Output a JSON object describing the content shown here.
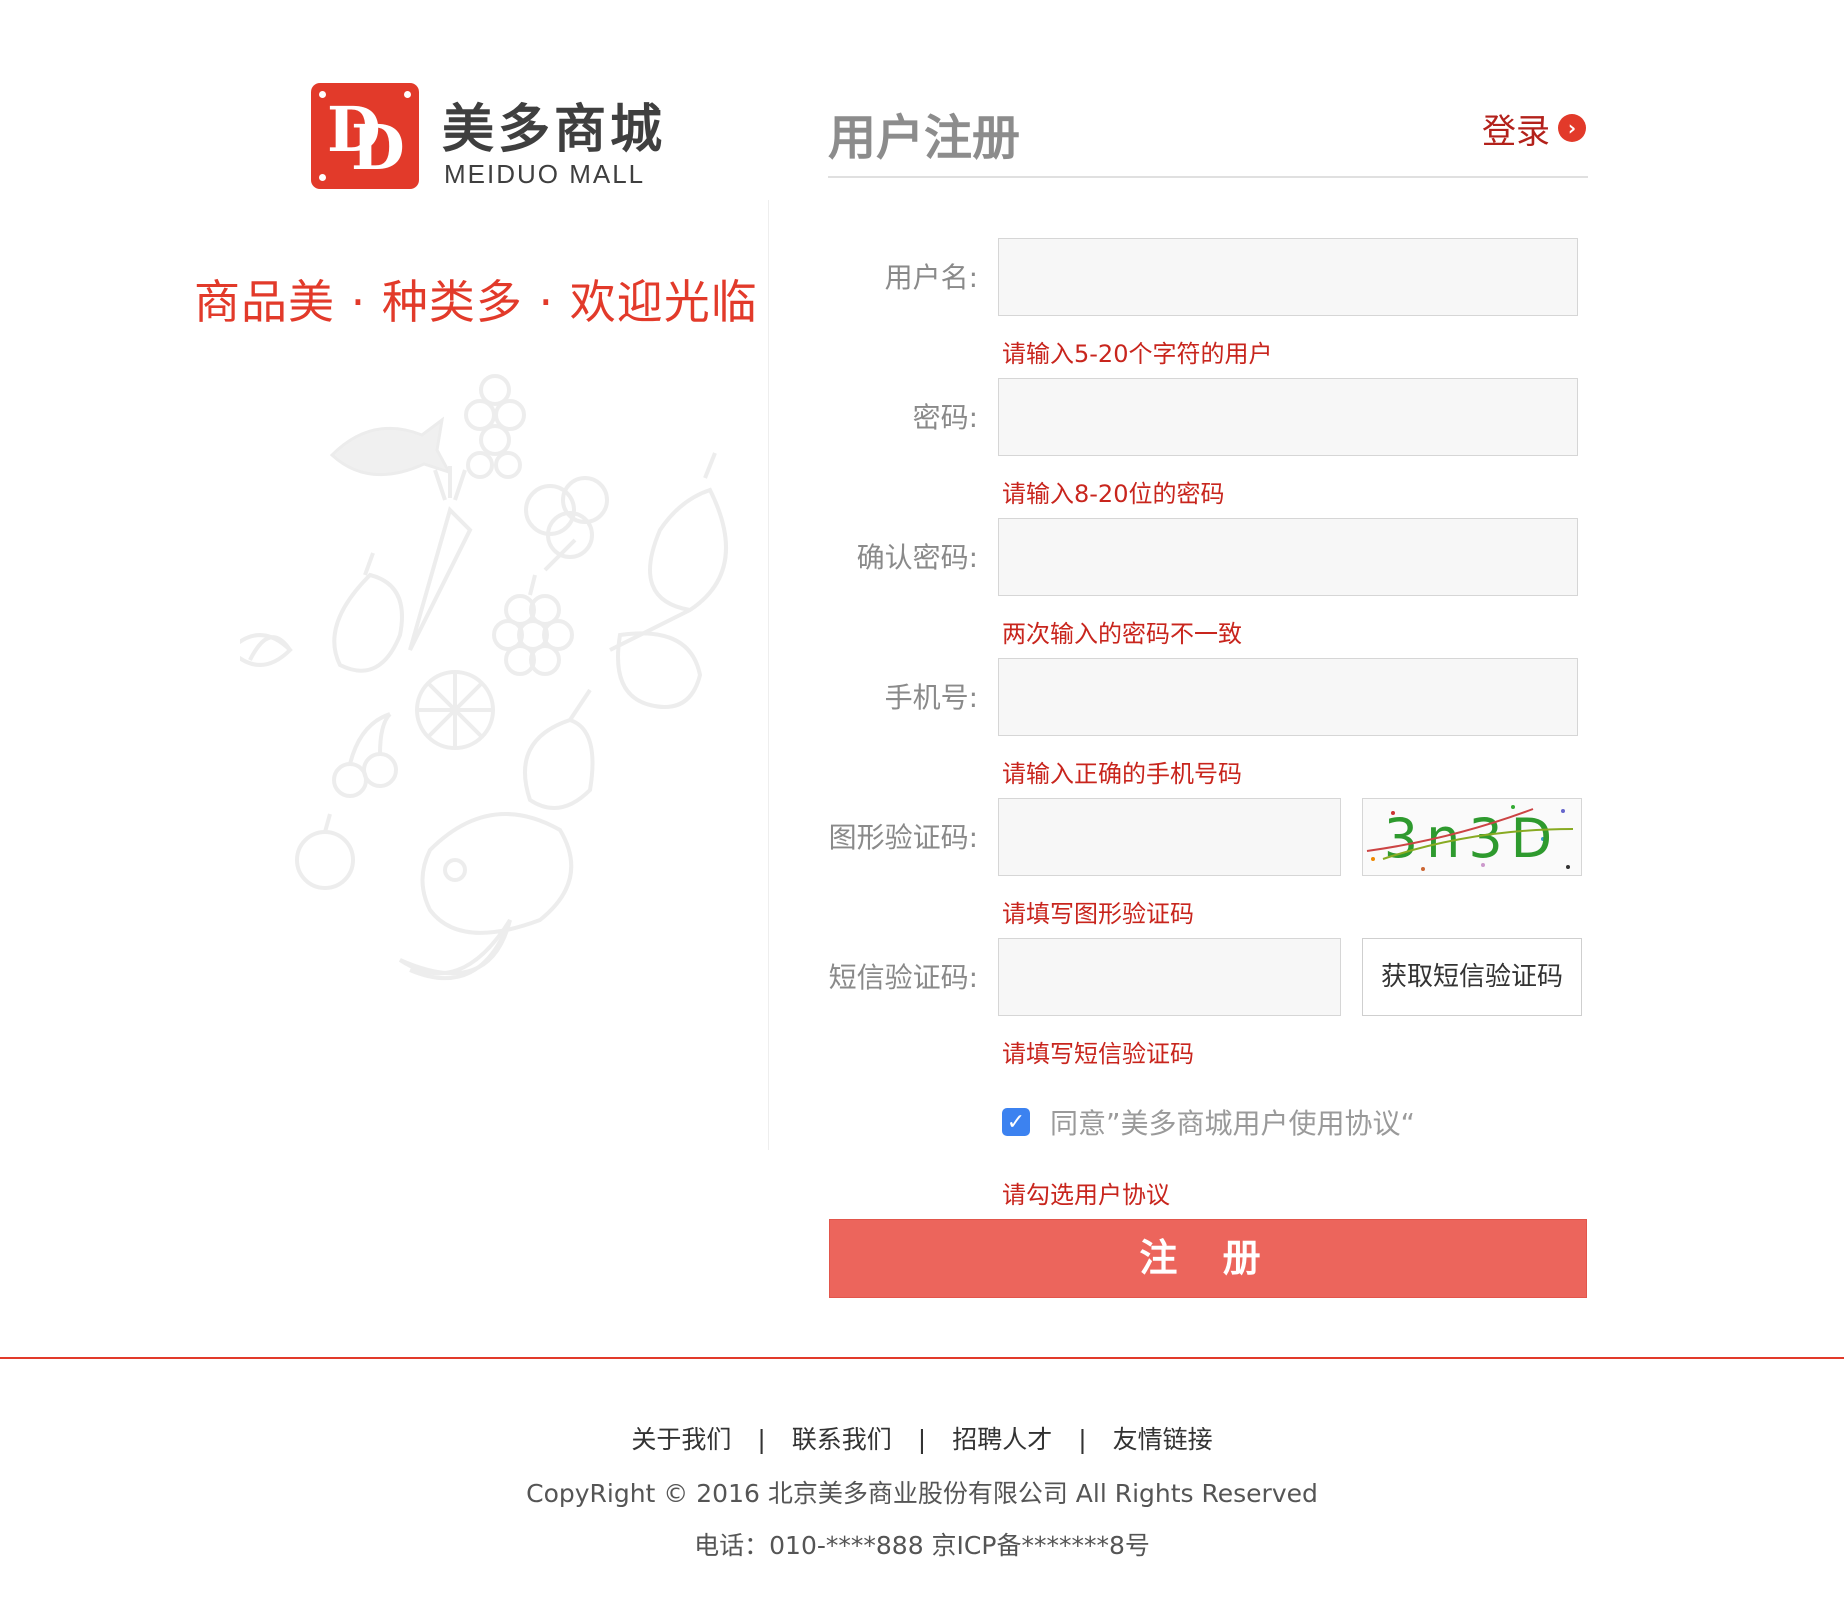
{
  "brand": {
    "logo_letters": "DD",
    "name": "美多商城",
    "subtitle": "MEIDUO MALL",
    "slogan": "商品美 · 种类多 · 欢迎光临",
    "color": "#e23a2a"
  },
  "form": {
    "title": "用户注册",
    "login_link": "登录",
    "fields": {
      "username": {
        "label": "用户名:",
        "value": "",
        "error": "请输入5-20个字符的用户"
      },
      "password": {
        "label": "密码:",
        "value": "",
        "error": "请输入8-20位的密码"
      },
      "password_confirm": {
        "label": "确认密码:",
        "value": "",
        "error": "两次输入的密码不一致"
      },
      "mobile": {
        "label": "手机号:",
        "value": "",
        "error": "请输入正确的手机号码"
      },
      "image_code": {
        "label": "图形验证码:",
        "value": "",
        "error": "请填写图形验证码",
        "captcha_text": "3n3D"
      },
      "sms_code": {
        "label": "短信验证码:",
        "value": "",
        "error": "请填写短信验证码",
        "button": "获取短信验证码"
      }
    },
    "agreement": {
      "checked": true,
      "text": "同意”美多商城用户使用协议“",
      "error": "请勾选用户协议"
    },
    "submit_label": "注 册",
    "submit_color": "#ec655c",
    "error_color": "#c8251d"
  },
  "footer": {
    "links": [
      "关于我们",
      "联系我们",
      "招聘人才",
      "友情链接"
    ],
    "separator": "|",
    "copyright": "CopyRight © 2016 北京美多商业股份有限公司 All Rights Reserved",
    "contact": "电话：010-****888 京ICP备*******8号"
  }
}
